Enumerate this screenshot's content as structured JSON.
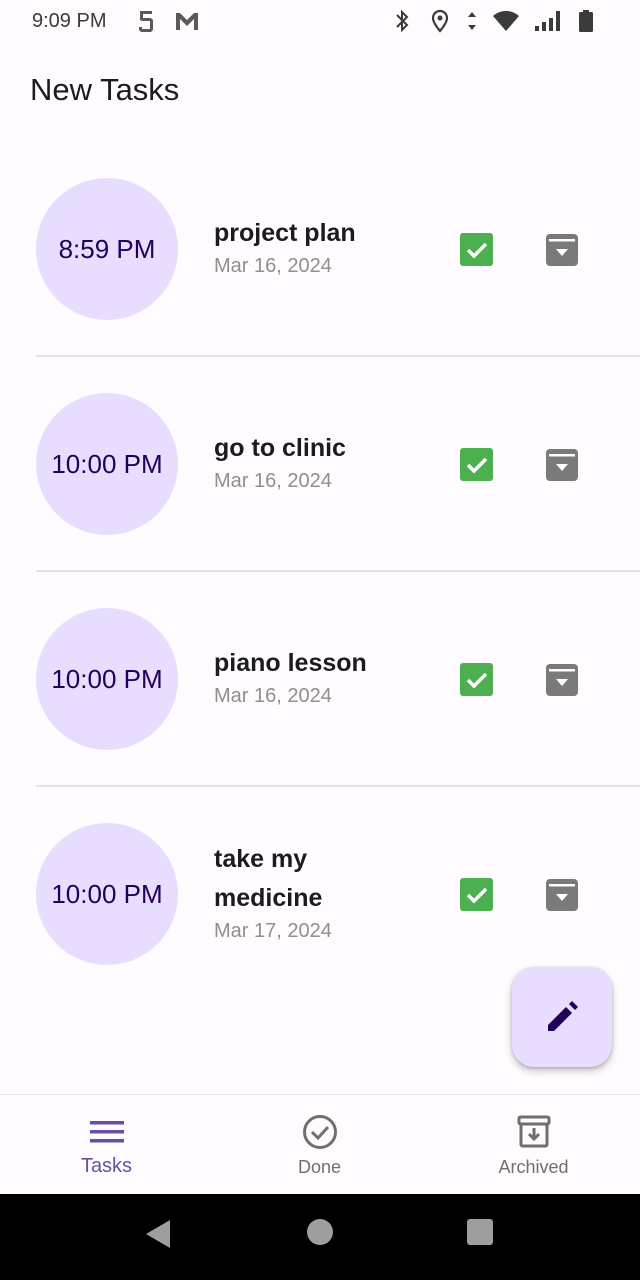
{
  "status_bar": {
    "time": "9:09 PM",
    "left_icons": [
      "sim-notification-icon",
      "gmail-icon"
    ],
    "right_icons": [
      "bluetooth-icon",
      "location-icon",
      "data-arrows-icon",
      "wifi-icon",
      "cell-signal-icon",
      "battery-icon"
    ]
  },
  "header": {
    "title": "New Tasks"
  },
  "tasks": [
    {
      "time": "8:59 PM",
      "title": "project plan",
      "date": "Mar 16, 2024"
    },
    {
      "time": "10:00 PM",
      "title": "go to clinic",
      "date": "Mar 16, 2024"
    },
    {
      "time": "10:00 PM",
      "title": "piano lesson",
      "date": "Mar 16, 2024"
    },
    {
      "time": "10:00 PM",
      "title": "take my medicine",
      "date": "Mar 17, 2024"
    }
  ],
  "fab": {
    "icon": "pencil-edit-icon"
  },
  "bottom_nav": {
    "items": [
      {
        "label": "Tasks",
        "icon": "menu-icon",
        "active": true
      },
      {
        "label": "Done",
        "icon": "check-circle-icon",
        "active": false
      },
      {
        "label": "Archived",
        "icon": "archive-icon",
        "active": false
      }
    ]
  },
  "colors": {
    "accent": "#6750a4",
    "time_circle_bg": "#e8ddff",
    "time_text": "#21005d",
    "check_green": "#4caf50",
    "archive_gray": "#7a7a7a",
    "background": "#fffbfe"
  }
}
